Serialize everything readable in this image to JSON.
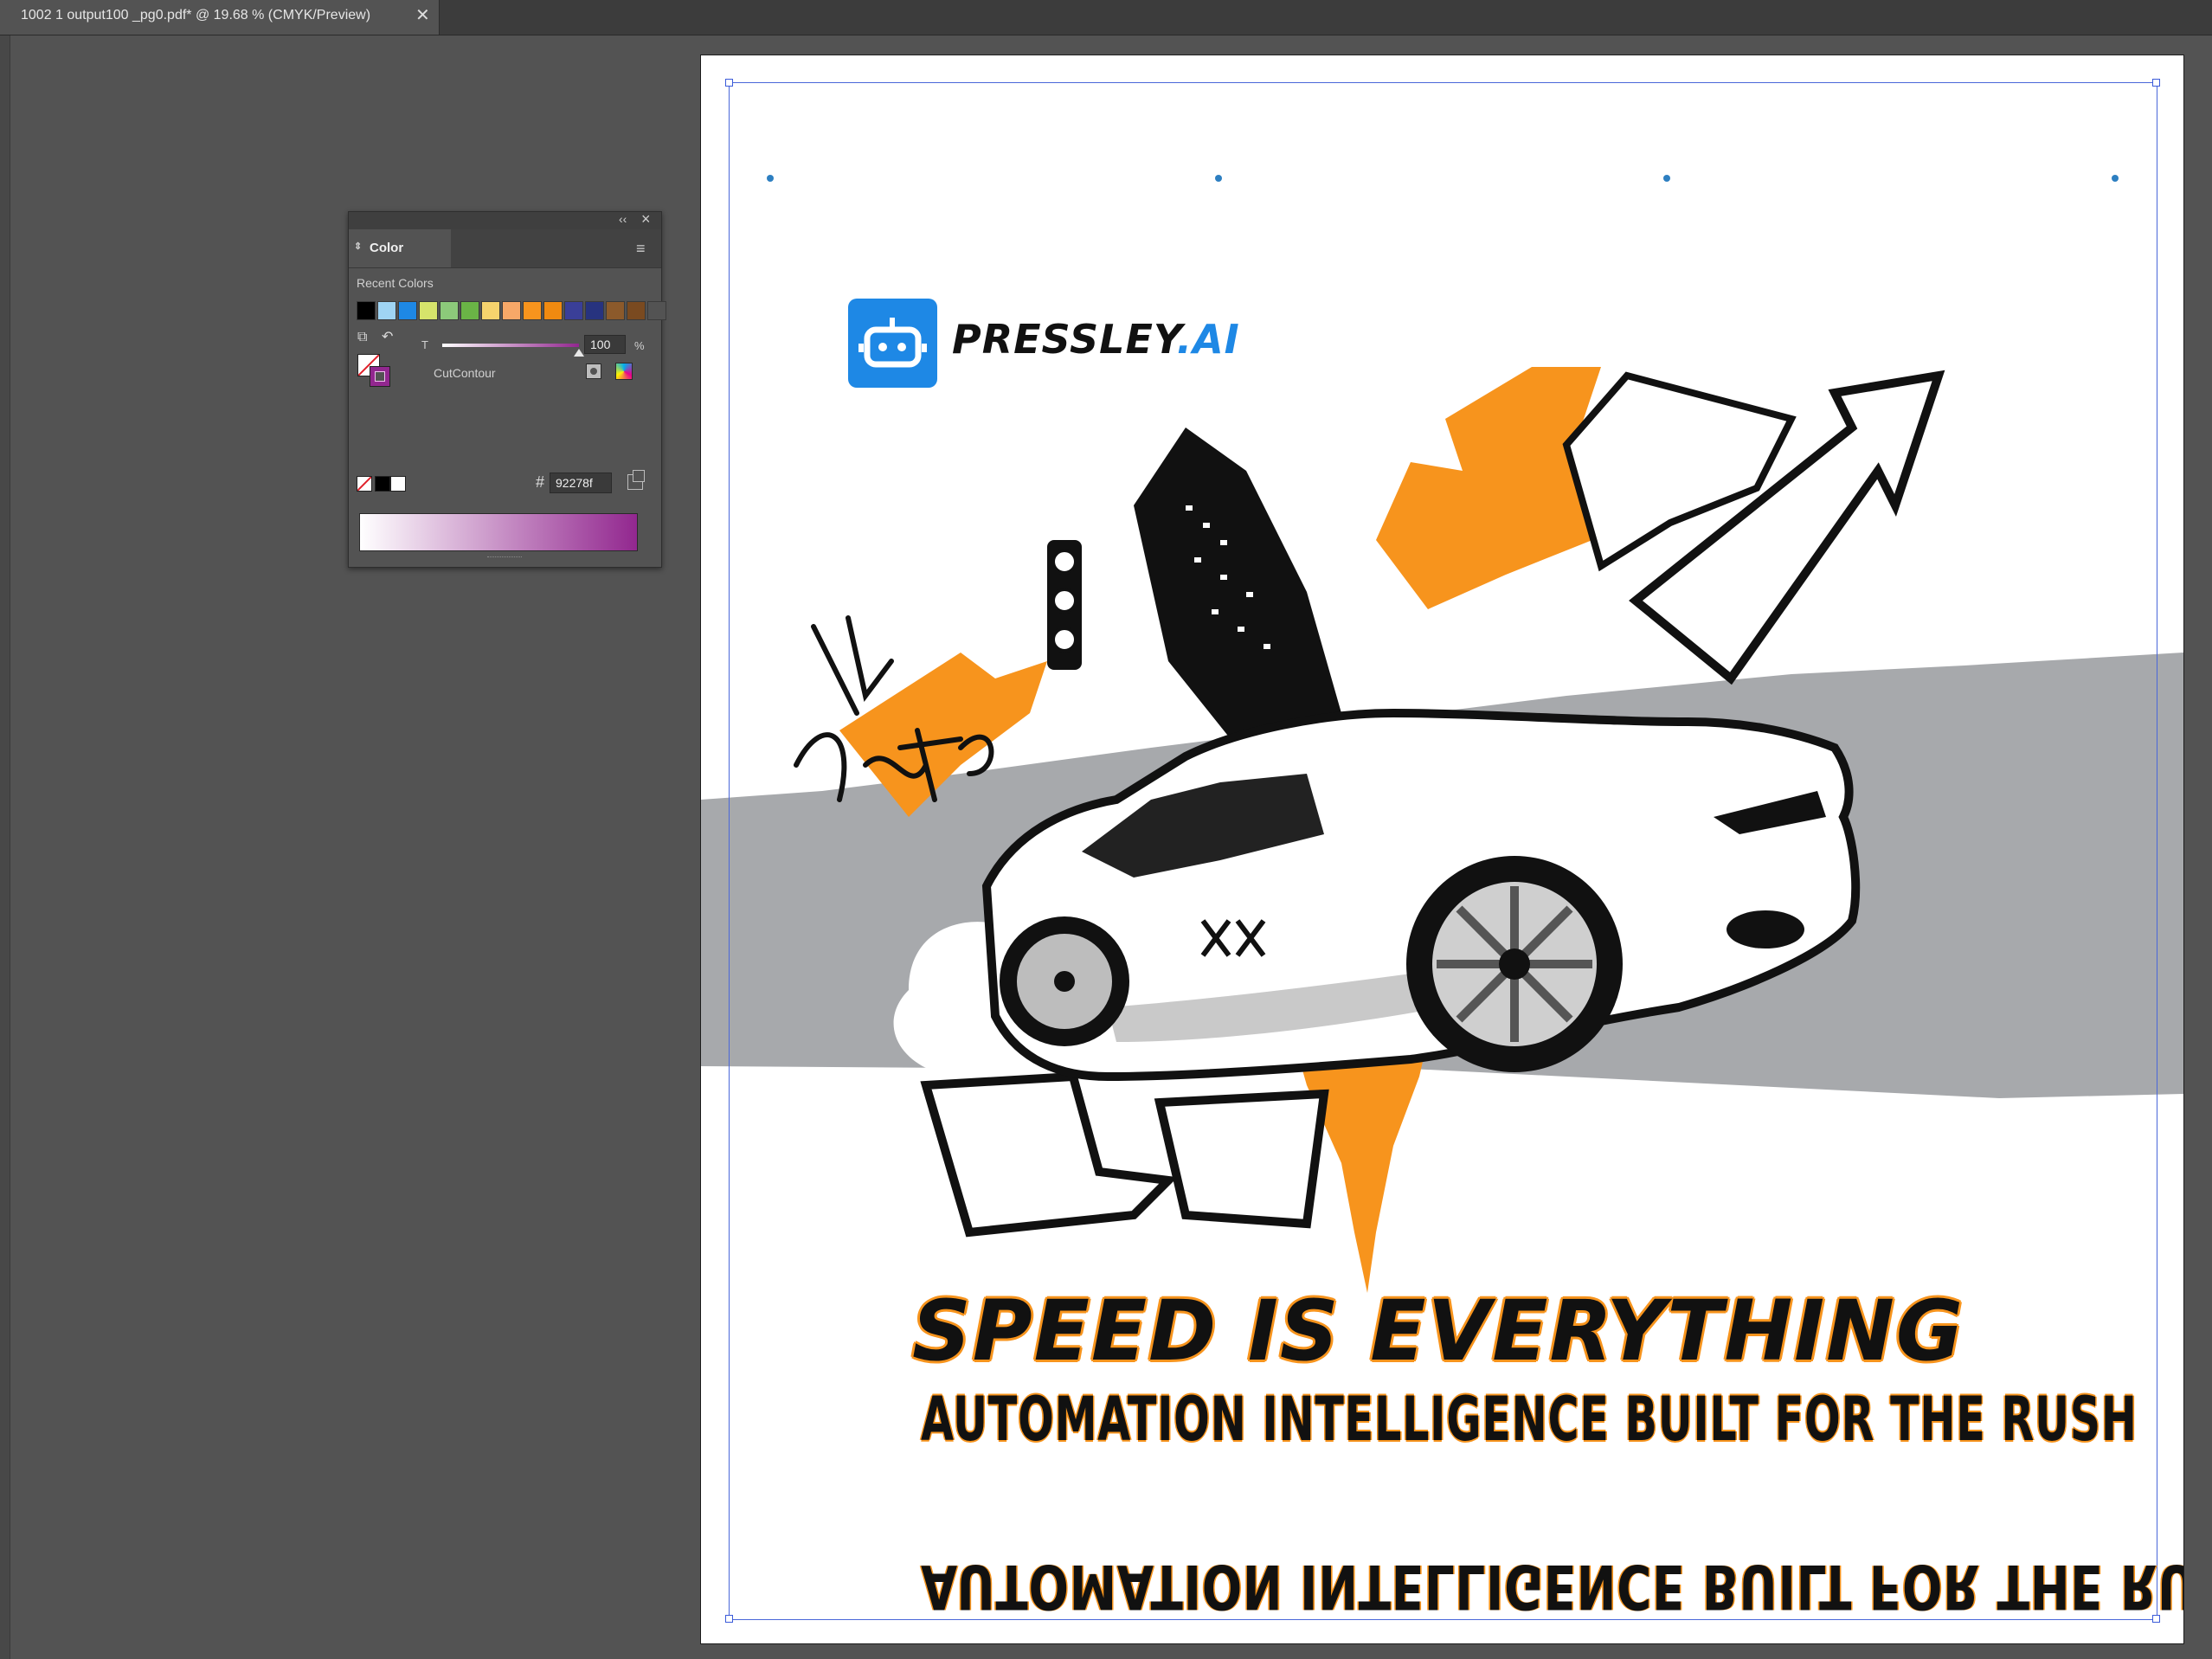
{
  "document_tab": {
    "title": "1002 1 output100 _pg0.pdf* @ 19.68 % (CMYK/Preview)",
    "close_glyph": "✕"
  },
  "color_panel": {
    "tab_label": "Color",
    "recent_colors_label": "Recent Colors",
    "recent_colors": [
      "#000000",
      "#9fd4f3",
      "#1e88e5",
      "#d6e36b",
      "#8cc97a",
      "#6ab446",
      "#f6d36d",
      "#f7a868",
      "#f7941d",
      "#f08a10",
      "#3a3f98",
      "#27337f",
      "#8c5a2b",
      "#7a4a20",
      "#535353"
    ],
    "tint_axis_label": "T",
    "tint_value": "100",
    "tint_unit": "%",
    "tint": 1.0,
    "swatch_name": "CutContour",
    "hex_sign": "#",
    "hex_value": "92278f",
    "current_color": "#92278f"
  },
  "artboard": {
    "brand_name": "PRESSLEY",
    "brand_suffix": ".AI",
    "brand_icon": "robot-icon",
    "tag_graffiti": "NY Ghetto",
    "car_plate_text": "XX",
    "headline": "SPEED IS EVERYTHING",
    "subheadline": "AUTOMATION INTELLIGENCE BUILT FOR THE RUSH",
    "colors": {
      "orange": "#f7941d",
      "gray_band": "#a7a9ac",
      "brand_blue": "#1e88e5"
    }
  }
}
